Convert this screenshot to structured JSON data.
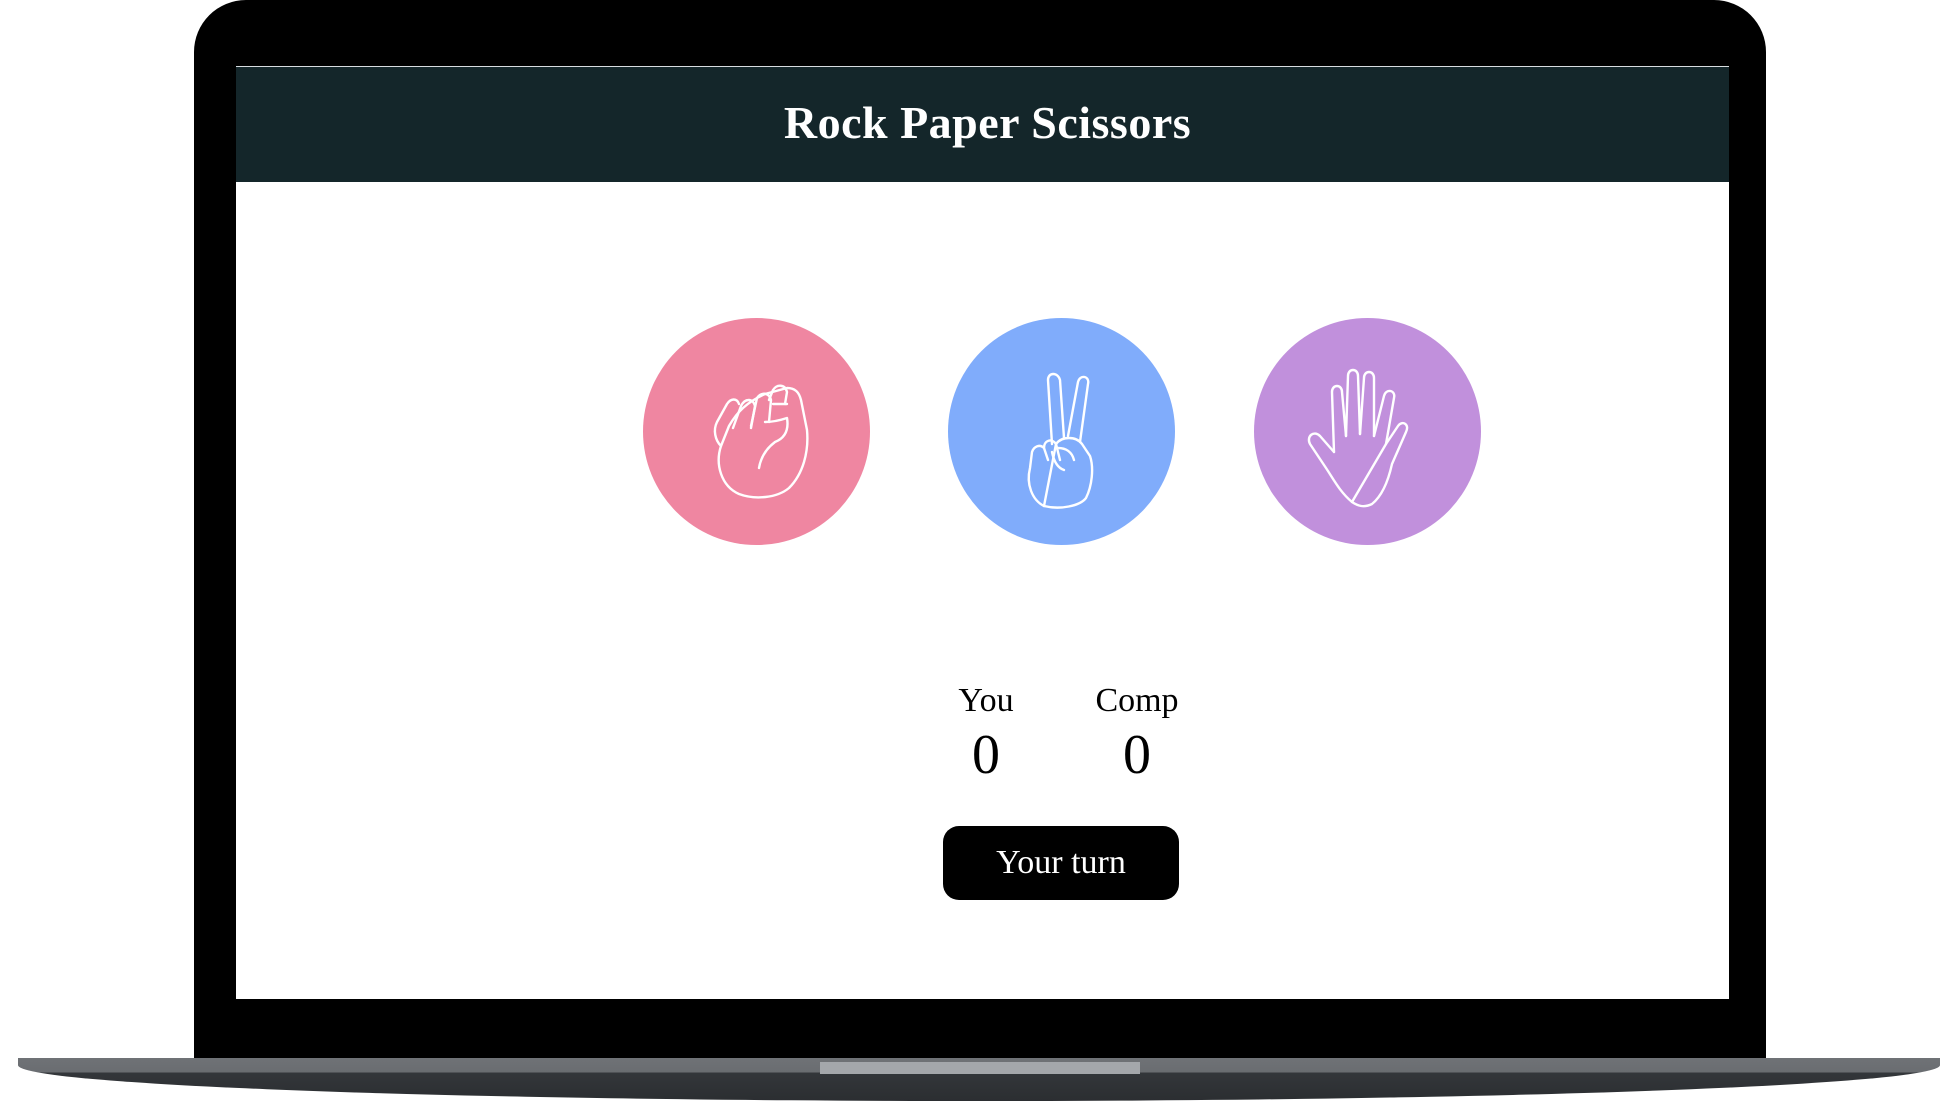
{
  "app": {
    "title": "Rock Paper Scissors"
  },
  "choices": [
    {
      "name": "rock",
      "color": "#ef86a1",
      "icon": "fist-icon"
    },
    {
      "name": "scissors",
      "color": "#80acfb",
      "icon": "peace-hand-icon"
    },
    {
      "name": "paper",
      "color": "#c190dc",
      "icon": "open-hand-icon"
    }
  ],
  "score": {
    "you_label": "You",
    "you_value": "0",
    "comp_label": "Comp",
    "comp_value": "0"
  },
  "turn_button": {
    "label": "Your turn"
  },
  "colors": {
    "header_bg": "#14262a",
    "button_bg": "#000000",
    "frame": "#000000"
  }
}
